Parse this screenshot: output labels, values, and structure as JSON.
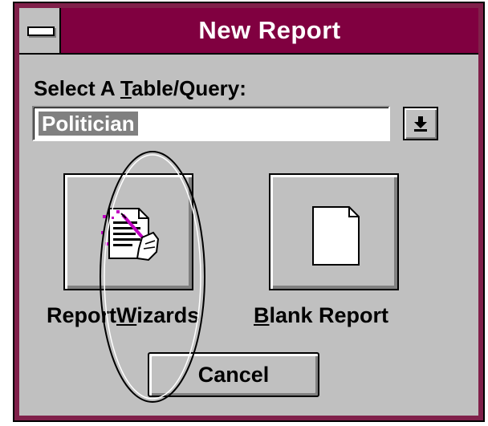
{
  "window": {
    "title": "New Report"
  },
  "table_query": {
    "label_before": "Select A ",
    "label_accel": "T",
    "label_after": "able/Query:",
    "value": "Politician"
  },
  "buttons": {
    "wizard_label_before": "Report",
    "wizard_label_accel": "W",
    "wizard_label_after": "izards",
    "blank_label_accel": "B",
    "blank_label_after": "lank Report",
    "cancel_label": "Cancel"
  },
  "colors": {
    "title_bar": "#800040",
    "dialog_face": "#c0c0c0",
    "selection": "#808080"
  },
  "icons": {
    "wizard": "report-wizard-icon",
    "blank": "blank-page-icon",
    "dropdown": "dropdown-arrow-icon",
    "system_menu": "system-menu-icon"
  }
}
